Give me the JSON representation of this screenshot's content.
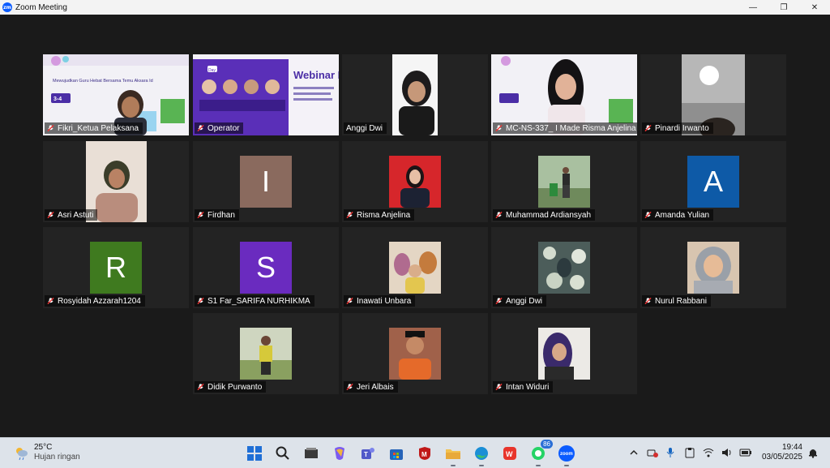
{
  "window": {
    "title": "Zoom Meeting",
    "app_logo_text": "zm",
    "controls": {
      "minimize": "—",
      "restore": "❐",
      "close": "✕"
    }
  },
  "participants": [
    {
      "name": "Fikri_Ketua Pelaksana",
      "kind": "slide-video",
      "active": true
    },
    {
      "name": "Operator",
      "kind": "webinar-slide"
    },
    {
      "name": "Anggi Dwi",
      "kind": "video"
    },
    {
      "name": "MC-NS-337_ I Made Risma Anjelina",
      "kind": "slide-video"
    },
    {
      "name": "Pinardi Irwanto",
      "kind": "video"
    },
    {
      "name": "Asri Astuti",
      "kind": "video"
    },
    {
      "name": "Firdhan",
      "kind": "letter",
      "letter": "I",
      "color": "#8a6a5e"
    },
    {
      "name": "Risma Anjelina",
      "kind": "photo"
    },
    {
      "name": "Muhammad Ardiansyah",
      "kind": "photo"
    },
    {
      "name": "Amanda Yulian",
      "kind": "letter",
      "letter": "A",
      "color": "#0e5aa7"
    },
    {
      "name": "Rosyidah Azzarah1204",
      "kind": "letter",
      "letter": "R",
      "color": "#3f7a1f"
    },
    {
      "name": "S1 Far_SARIFA NURHIKMA",
      "kind": "letter",
      "letter": "S",
      "color": "#6a2bbf"
    },
    {
      "name": "Inawati Unbara",
      "kind": "photo"
    },
    {
      "name": "Anggi Dwi",
      "kind": "photo"
    },
    {
      "name": "Nurul Rabbani",
      "kind": "photo"
    },
    {
      "name": "Didik Purwanto",
      "kind": "photo"
    },
    {
      "name": "Jeri Albais",
      "kind": "photo"
    },
    {
      "name": "Intan Widuri",
      "kind": "photo"
    }
  ],
  "slide_text": {
    "headline": "Mewujudkan Guru Hebat Bersama Temu Aksara Id",
    "dates": "3-4",
    "webinar_title": "Webinar Nasional",
    "day": "Day 1"
  },
  "taskbar": {
    "weather": {
      "temp": "25°C",
      "desc": "Hujan ringan"
    },
    "pinned": [
      "windows-start",
      "search",
      "file-explorer",
      "copilot",
      "teams",
      "store",
      "mcafee",
      "file-folder",
      "edge",
      "wps-office",
      "whatsapp",
      "zoom"
    ],
    "whatsapp_badge": "86",
    "zoom_label": "zoom",
    "clock": {
      "time": "19:44",
      "date": "03/05/2025"
    }
  }
}
